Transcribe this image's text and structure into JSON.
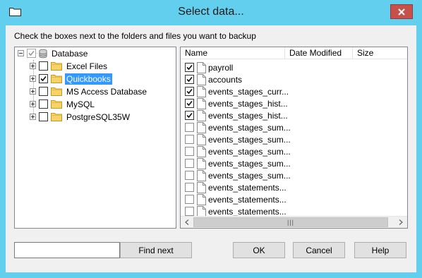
{
  "window": {
    "title": "Select data...",
    "accent": "#62cfef",
    "close_color": "#c7504b"
  },
  "instruction": "Check the boxes next to the folders and files you want to backup",
  "tree": {
    "root": {
      "label": "Database",
      "checked": "partial"
    },
    "items": [
      {
        "label": "Excel Files",
        "checked": false,
        "selected": false
      },
      {
        "label": "Quickbooks",
        "checked": true,
        "selected": true
      },
      {
        "label": "MS Access Database",
        "checked": false,
        "selected": false
      },
      {
        "label": "MySQL",
        "checked": false,
        "selected": false
      },
      {
        "label": "PostgreSQL35W",
        "checked": false,
        "selected": false
      }
    ]
  },
  "list": {
    "columns": [
      "Name",
      "Date Modified",
      "Size"
    ],
    "rows": [
      {
        "name": "payroll",
        "checked": true
      },
      {
        "name": "accounts",
        "checked": true
      },
      {
        "name": "events_stages_curr...",
        "checked": true
      },
      {
        "name": "events_stages_hist...",
        "checked": true
      },
      {
        "name": "events_stages_hist...",
        "checked": true
      },
      {
        "name": "events_stages_sum...",
        "checked": false
      },
      {
        "name": "events_stages_sum...",
        "checked": false
      },
      {
        "name": "events_stages_sum...",
        "checked": false
      },
      {
        "name": "events_stages_sum...",
        "checked": false
      },
      {
        "name": "events_stages_sum...",
        "checked": false
      },
      {
        "name": "events_statements...",
        "checked": false
      },
      {
        "name": "events_statements...",
        "checked": false
      },
      {
        "name": "events_statements...",
        "checked": false
      }
    ],
    "scrollbar_grip": "|||"
  },
  "search": {
    "value": ""
  },
  "buttons": {
    "find_next": "Find next",
    "ok": "OK",
    "cancel": "Cancel",
    "help": "Help"
  },
  "icons": {
    "title": "folder-icon",
    "close": "close-icon",
    "tree_root": "database-icon",
    "tree_items": "folder-icon",
    "list_items": "file-icon"
  }
}
